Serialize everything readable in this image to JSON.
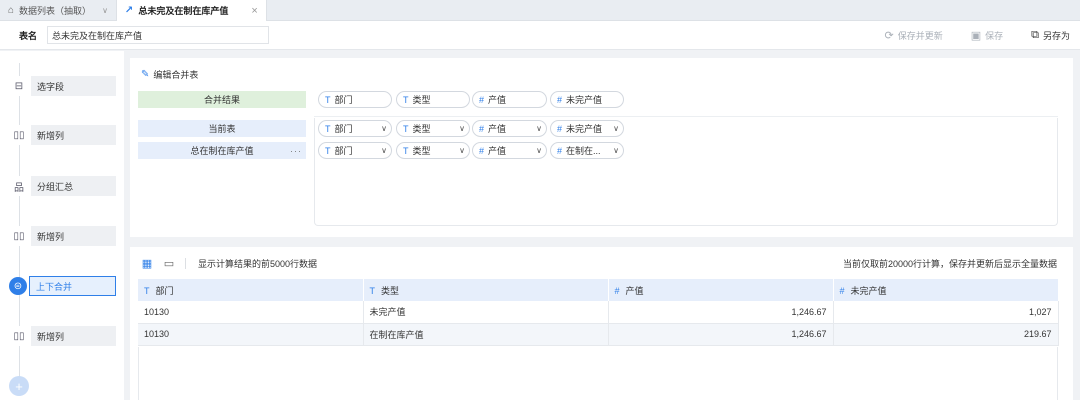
{
  "tabs": [
    {
      "label": "数据列表（抽取）",
      "icon": "home-icon"
    },
    {
      "label": "总未完及在制在库产值",
      "icon": "line-chart-icon"
    }
  ],
  "namebar": {
    "label": "表名",
    "value": "总未完及在制在库产值",
    "actions": {
      "save_update": "保存并更新",
      "save": "保存",
      "save_as": "另存为"
    }
  },
  "steps": [
    {
      "label": "选字段",
      "icon": "select-field-icon"
    },
    {
      "label": "新增列",
      "icon": "add-column-icon"
    },
    {
      "label": "分组汇总",
      "icon": "group-summary-icon"
    },
    {
      "label": "新增列",
      "icon": "add-column-icon"
    },
    {
      "label": "上下合并",
      "icon": "union-icon",
      "active": true
    },
    {
      "label": "新增列",
      "icon": "add-column-icon"
    }
  ],
  "merge": {
    "edit_label": "编辑合并表",
    "result_label": "合并结果",
    "result_fields": [
      {
        "type": "T",
        "name": "部门"
      },
      {
        "type": "T",
        "name": "类型"
      },
      {
        "type": "#",
        "name": "产值"
      },
      {
        "type": "#",
        "name": "未完产值"
      }
    ],
    "tables": [
      {
        "name": "当前表",
        "fields": [
          {
            "type": "T",
            "name": "部门"
          },
          {
            "type": "T",
            "name": "类型"
          },
          {
            "type": "#",
            "name": "产值"
          },
          {
            "type": "#",
            "name": "未完产值"
          }
        ]
      },
      {
        "name": "总在制在库产值",
        "more": "···",
        "fields": [
          {
            "type": "T",
            "name": "部门"
          },
          {
            "type": "T",
            "name": "类型"
          },
          {
            "type": "#",
            "name": "产值"
          },
          {
            "type": "#",
            "name": "在制在..."
          }
        ]
      }
    ]
  },
  "preview": {
    "info": "显示计算结果的前5000行数据",
    "note": "当前仅取前20000行计算，保存并更新后显示全量数据",
    "columns": [
      {
        "type": "T",
        "name": "部门"
      },
      {
        "type": "T",
        "name": "类型"
      },
      {
        "type": "#",
        "name": "产值"
      },
      {
        "type": "#",
        "name": "未完产值"
      }
    ],
    "rows": [
      [
        "10130",
        "未完产值",
        "1,246.67",
        "1,027"
      ],
      [
        "10130",
        "在制在库产值",
        "1,246.67",
        "219.67"
      ]
    ]
  },
  "colors": {
    "accent": "#2f7fe8",
    "result_bg": "#dff0dc",
    "table_bg": "#e6eefb"
  }
}
